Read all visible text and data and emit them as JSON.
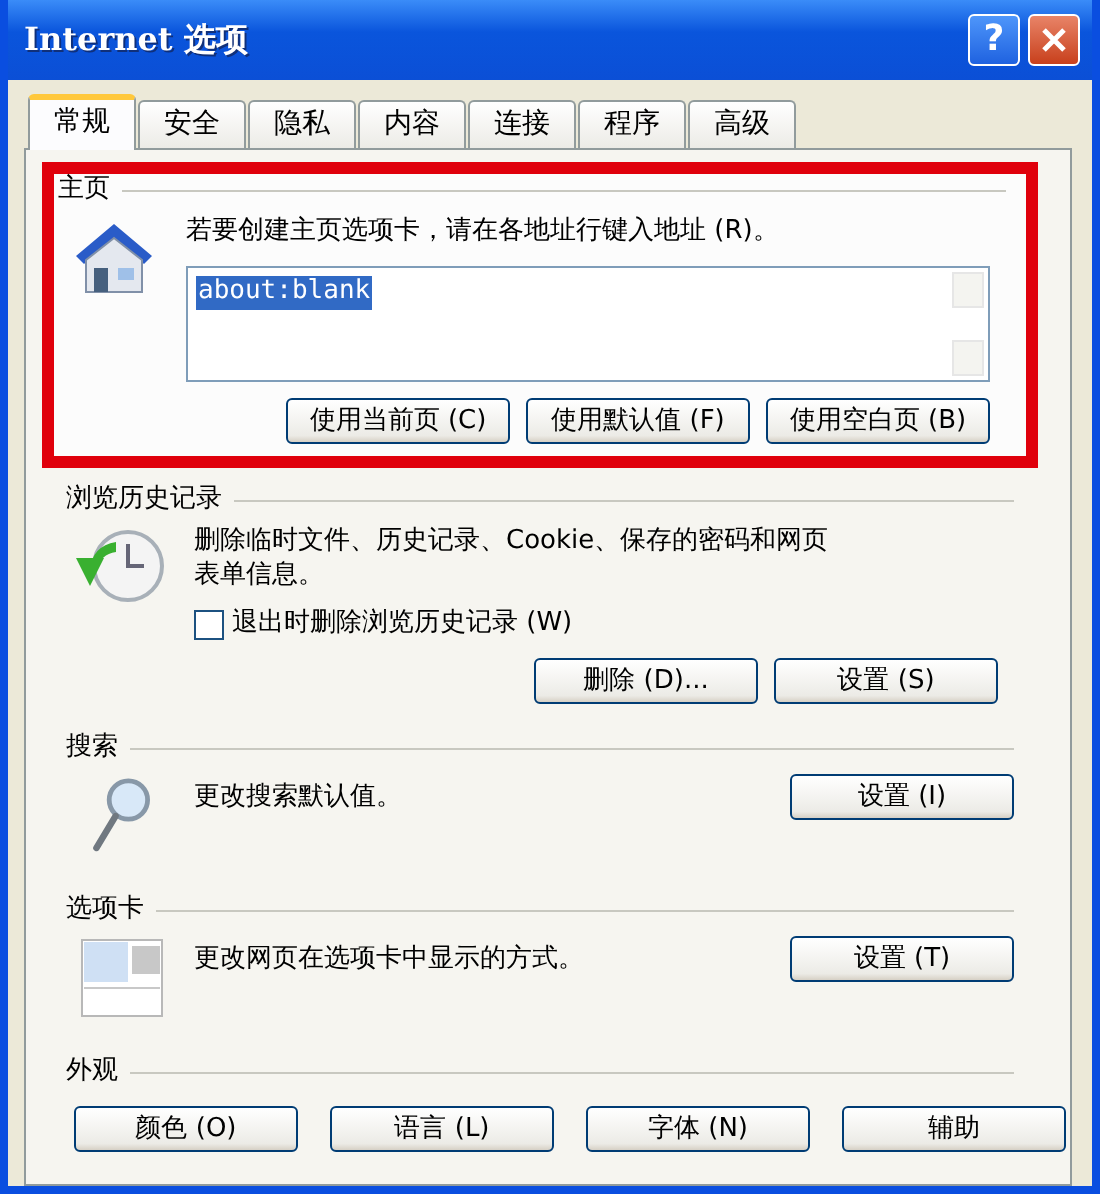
{
  "window": {
    "title": "Internet 选项",
    "help_button": "?"
  },
  "tabs": [
    {
      "label": "常规",
      "selected": true
    },
    {
      "label": "安全",
      "selected": false
    },
    {
      "label": "隐私",
      "selected": false
    },
    {
      "label": "内容",
      "selected": false
    },
    {
      "label": "连接",
      "selected": false
    },
    {
      "label": "程序",
      "selected": false
    },
    {
      "label": "高级",
      "selected": false
    }
  ],
  "sections": [
    {
      "kind": "homepage",
      "heading": "主页",
      "highlighted": true,
      "description": "若要创建主页选项卡，请在各地址行键入地址 (R)。",
      "url": "about:blank",
      "buttons": [
        "使用当前页 (C)",
        "使用默认值 (F)",
        "使用空白页 (B)"
      ]
    },
    {
      "kind": "history",
      "heading": "浏览历史记录",
      "highlighted": false,
      "description": "删除临时文件、历史记录、Cookie、保存的密码和网页表单信息。",
      "checkbox": {
        "label": "退出时删除浏览历史记录 (W)",
        "checked": false
      },
      "buttons": [
        "删除 (D)...",
        "设置 (S)"
      ]
    },
    {
      "kind": "search",
      "heading": "搜索",
      "highlighted": false,
      "description": "更改搜索默认值。",
      "buttons": [
        "设置 (I)"
      ]
    },
    {
      "kind": "tabs",
      "heading": "选项卡",
      "highlighted": false,
      "description": "更改网页在选项卡中显示的方式。",
      "buttons": [
        "设置 (T)"
      ]
    },
    {
      "kind": "appearance",
      "heading": "外观",
      "highlighted": false,
      "buttons": [
        "颜色 (O)",
        "语言 (L)",
        "字体 (N)",
        "辅助"
      ]
    }
  ]
}
